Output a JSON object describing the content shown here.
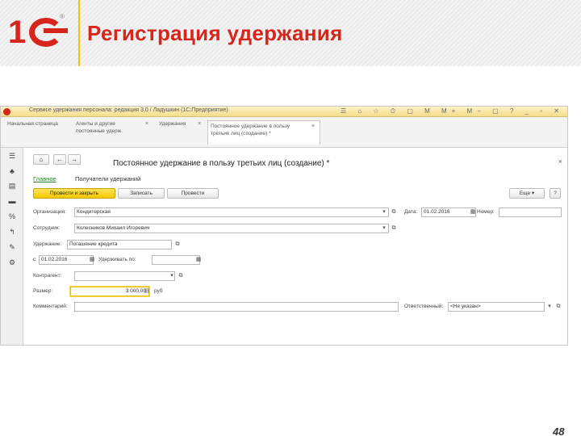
{
  "slide": {
    "title": "Регистрация удержания",
    "page_number": "48",
    "logo_text": "1С",
    "brand_color": "#d6251b",
    "accent_color": "#f5c400"
  },
  "window": {
    "title_text": "Сервисе удержания персонала: редакция 3.0 / Ладушкин (1С:Предприятие)",
    "tabs": [
      {
        "label": "Начальная страница"
      },
      {
        "label": "Агенты и другие постоянные удерж.",
        "close": "×"
      },
      {
        "label": "Удержания",
        "close": "×"
      },
      {
        "label": "Постоянное удержание в пользу третьих лиц (создание) *",
        "close": "×"
      }
    ]
  },
  "sidebar": {
    "icons": [
      "menu-icon",
      "users-icon",
      "list-icon",
      "table-icon",
      "percent-icon",
      "arrow-icon",
      "wrench-icon",
      "gear-icon"
    ]
  },
  "document": {
    "title": "Постоянное удержание в пользу третьих лиц (создание) *",
    "nav_back": "←",
    "nav_forward": "→",
    "nav_home": "⌂",
    "close": "×",
    "links": {
      "main": "Главное",
      "recipients": "Получатели удержаний"
    },
    "buttons": {
      "post_and_close": "Провести и закрыть",
      "save": "Записать",
      "post": "Провести",
      "more": "Еще ▾",
      "help": "?"
    },
    "fields": {
      "organization_label": "Организация:",
      "organization_value": "Кондитерская",
      "date_label": "Дата:",
      "date_value": "01.02.2016",
      "number_label": "Номер:",
      "number_value": "",
      "employee_label": "Сотрудник:",
      "employee_value": "Колесников Михаил Игоревич",
      "deduction_label": "Удержание:",
      "deduction_value": "Погашение кредита",
      "from_label": "с",
      "from_value": "01.02.2016",
      "to_label": "Удерживать по:",
      "to_value": "",
      "counterparty_label": "Контрагент:",
      "counterparty_value": "",
      "amount_label": "Размер:",
      "amount_value": "3 000,00",
      "currency": "руб",
      "comment_label": "Комментарий:",
      "comment_value": "",
      "responsible_label": "Ответственный:",
      "responsible_value": "<Не указан>"
    }
  }
}
